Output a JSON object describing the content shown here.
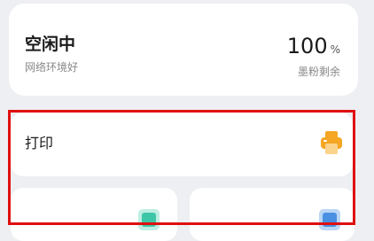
{
  "status": {
    "title": "空闲中",
    "subtitle": "网络环境好",
    "toner_value": "100",
    "toner_unit": "%",
    "toner_label": "墨粉剩余"
  },
  "actions": {
    "print_label": "打印",
    "print_icon": "printer-icon",
    "tile_left_icon": "scan-icon",
    "tile_right_icon": "copy-icon"
  },
  "colors": {
    "print_icon": "#f5a623",
    "tile_left_icon": "#3ec6a8",
    "tile_right_icon": "#4a90e2",
    "highlight": "#e01010"
  }
}
